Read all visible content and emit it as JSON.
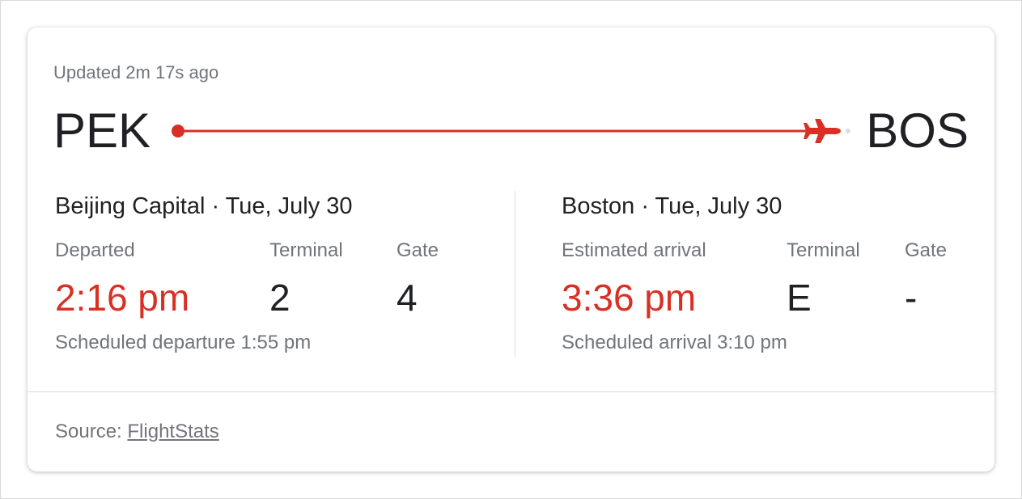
{
  "updated": "Updated 2m 17s ago",
  "origin": {
    "code": "PEK",
    "place_date": "Beijing Capital · Tue, July 30",
    "status_label": "Departed",
    "time": "2:16 pm",
    "terminal_label": "Terminal",
    "terminal": "2",
    "gate_label": "Gate",
    "gate": "4",
    "scheduled": "Scheduled departure 1:55 pm"
  },
  "destination": {
    "code": "BOS",
    "place_date": "Boston · Tue, July 30",
    "status_label": "Estimated arrival",
    "time": "3:36 pm",
    "terminal_label": "Terminal",
    "terminal": "E",
    "gate_label": "Gate",
    "gate": "-",
    "scheduled": "Scheduled arrival 3:10 pm"
  },
  "route": {
    "icon": "airplane-icon",
    "progress": 1.0
  },
  "source": {
    "prefix": "Source: ",
    "link": "FlightStats"
  },
  "colors": {
    "accent_red": "#d93025",
    "text_primary": "#202124",
    "text_secondary": "#70757a"
  }
}
